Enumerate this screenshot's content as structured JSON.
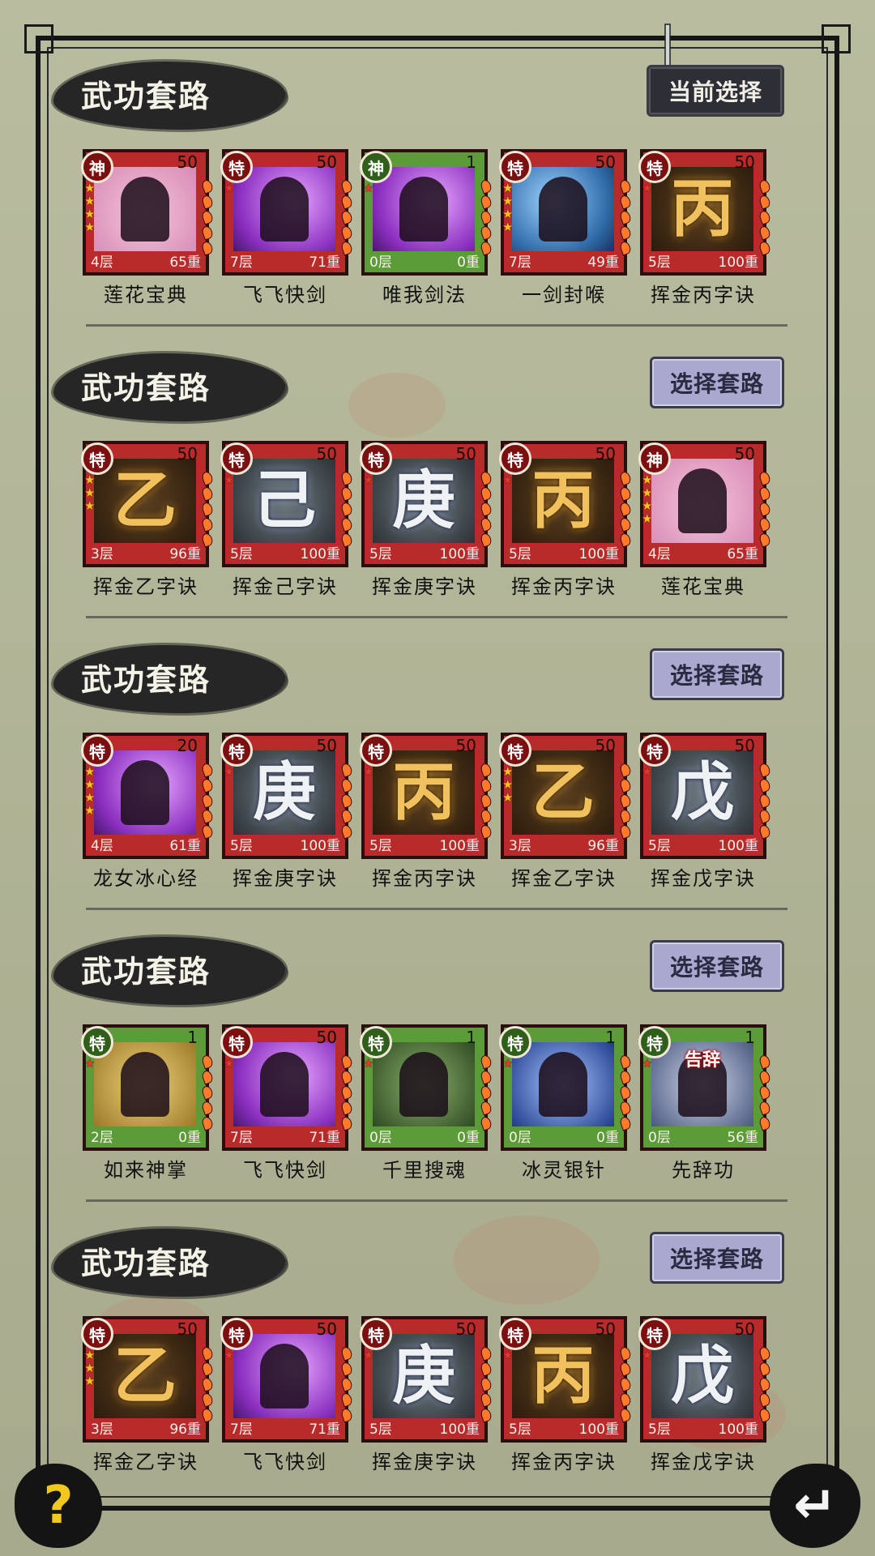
{
  "sections": [
    {
      "title": "武功套路",
      "button": "当前选择",
      "cards": [
        {
          "badge": "神",
          "level": "50",
          "layers": "4层",
          "weight": "65重",
          "name": "莲花宝典",
          "glyph": "",
          "stars": 4,
          "frame": "red"
        },
        {
          "badge": "特",
          "level": "50",
          "layers": "7层",
          "weight": "71重",
          "name": "飞飞快剑",
          "glyph": "",
          "stars": 1,
          "frame": "red"
        },
        {
          "badge": "神",
          "level": "1",
          "layers": "0层",
          "weight": "0重",
          "name": "唯我剑法",
          "glyph": "",
          "stars": 1,
          "frame": "green"
        },
        {
          "badge": "特",
          "level": "50",
          "layers": "7层",
          "weight": "49重",
          "name": "一剑封喉",
          "glyph": "",
          "stars": 4,
          "frame": "red"
        },
        {
          "badge": "特",
          "level": "50",
          "layers": "5层",
          "weight": "100重",
          "name": "挥金丙字诀",
          "glyph": "丙",
          "stars": 1,
          "frame": "red"
        }
      ]
    },
    {
      "title": "武功套路",
      "button": "选择套路",
      "cards": [
        {
          "badge": "特",
          "level": "50",
          "layers": "3层",
          "weight": "96重",
          "name": "挥金乙字诀",
          "glyph": "乙",
          "stars": 3,
          "frame": "red"
        },
        {
          "badge": "特",
          "level": "50",
          "layers": "5层",
          "weight": "100重",
          "name": "挥金己字诀",
          "glyph": "己",
          "stars": 1,
          "frame": "red"
        },
        {
          "badge": "特",
          "level": "50",
          "layers": "5层",
          "weight": "100重",
          "name": "挥金庚字诀",
          "glyph": "庚",
          "stars": 1,
          "frame": "red"
        },
        {
          "badge": "特",
          "level": "50",
          "layers": "5层",
          "weight": "100重",
          "name": "挥金丙字诀",
          "glyph": "丙",
          "stars": 1,
          "frame": "red"
        },
        {
          "badge": "神",
          "level": "50",
          "layers": "4层",
          "weight": "65重",
          "name": "莲花宝典",
          "glyph": "",
          "stars": 4,
          "frame": "red"
        }
      ]
    },
    {
      "title": "武功套路",
      "button": "选择套路",
      "cards": [
        {
          "badge": "特",
          "level": "20",
          "layers": "4层",
          "weight": "61重",
          "name": "龙女冰心经",
          "glyph": "",
          "stars": 4,
          "frame": "red"
        },
        {
          "badge": "特",
          "level": "50",
          "layers": "5层",
          "weight": "100重",
          "name": "挥金庚字诀",
          "glyph": "庚",
          "stars": 1,
          "frame": "red"
        },
        {
          "badge": "特",
          "level": "50",
          "layers": "5层",
          "weight": "100重",
          "name": "挥金丙字诀",
          "glyph": "丙",
          "stars": 1,
          "frame": "red"
        },
        {
          "badge": "特",
          "level": "50",
          "layers": "3层",
          "weight": "96重",
          "name": "挥金乙字诀",
          "glyph": "乙",
          "stars": 3,
          "frame": "red"
        },
        {
          "badge": "特",
          "level": "50",
          "layers": "5层",
          "weight": "100重",
          "name": "挥金戊字诀",
          "glyph": "戊",
          "stars": 1,
          "frame": "red"
        }
      ]
    },
    {
      "title": "武功套路",
      "button": "选择套路",
      "cards": [
        {
          "badge": "特",
          "level": "1",
          "layers": "2层",
          "weight": "0重",
          "name": "如来神掌",
          "glyph": "",
          "stars": 1,
          "frame": "green"
        },
        {
          "badge": "特",
          "level": "50",
          "layers": "7层",
          "weight": "71重",
          "name": "飞飞快剑",
          "glyph": "",
          "stars": 1,
          "frame": "red"
        },
        {
          "badge": "特",
          "level": "1",
          "layers": "0层",
          "weight": "0重",
          "name": "千里搜魂",
          "glyph": "",
          "stars": 1,
          "frame": "green"
        },
        {
          "badge": "特",
          "level": "1",
          "layers": "0层",
          "weight": "0重",
          "name": "冰灵银针",
          "glyph": "",
          "stars": 1,
          "frame": "green"
        },
        {
          "badge": "特",
          "level": "1",
          "layers": "0层",
          "weight": "56重",
          "name": "先辞功",
          "glyph": "",
          "stars": 1,
          "frame": "green",
          "caption": "告辞"
        }
      ]
    },
    {
      "title": "武功套路",
      "button": "选择套路",
      "cards": [
        {
          "badge": "特",
          "level": "50",
          "layers": "3层",
          "weight": "96重",
          "name": "挥金乙字诀",
          "glyph": "乙",
          "stars": 3,
          "frame": "red"
        },
        {
          "badge": "特",
          "level": "50",
          "layers": "7层",
          "weight": "71重",
          "name": "飞飞快剑",
          "glyph": "",
          "stars": 1,
          "frame": "red"
        },
        {
          "badge": "特",
          "level": "50",
          "layers": "5层",
          "weight": "100重",
          "name": "挥金庚字诀",
          "glyph": "庚",
          "stars": 1,
          "frame": "red"
        },
        {
          "badge": "特",
          "level": "50",
          "layers": "5层",
          "weight": "100重",
          "name": "挥金丙字诀",
          "glyph": "丙",
          "stars": 1,
          "frame": "red"
        },
        {
          "badge": "特",
          "level": "50",
          "layers": "5层",
          "weight": "100重",
          "name": "挥金戊字诀",
          "glyph": "戊",
          "stars": 1,
          "frame": "red"
        }
      ]
    }
  ],
  "footer": {
    "help_label": "?",
    "back_label": "↵"
  }
}
